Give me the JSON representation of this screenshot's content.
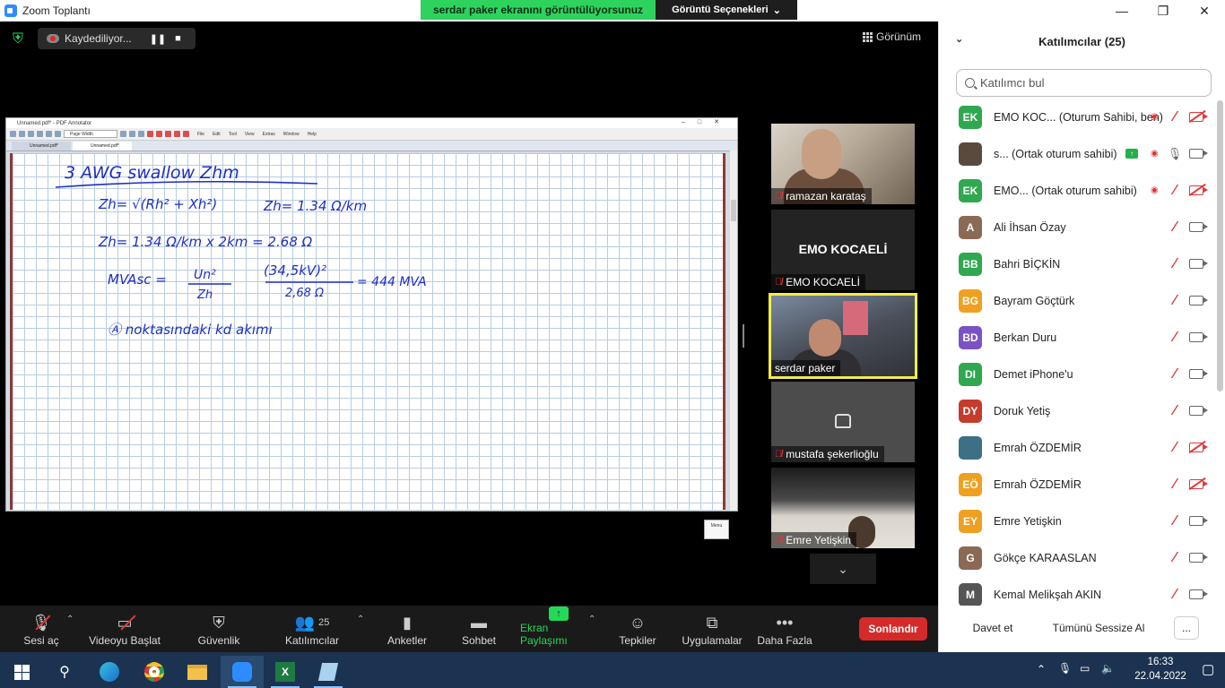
{
  "window": {
    "title": "Zoom Toplantı",
    "share_banner": "serdar paker ekranını görüntülüyorsunuz",
    "view_options": "Görüntü Seçenekleri",
    "min": "—",
    "max": "❐",
    "close": "✕"
  },
  "meeting": {
    "recording_label": "Kaydediliyor...",
    "view_label": "Görünüm"
  },
  "pdf_annotator": {
    "title": "Unnamed.pdf* - PDF Annotator",
    "zoom_value": "Page Width",
    "menus": [
      "File",
      "Edit",
      "Tool",
      "View",
      "Extras",
      "Window",
      "Help"
    ],
    "tabs": [
      "Unnamed.pdf*",
      "Unnamed.pdf*"
    ],
    "menu_button": "Menu"
  },
  "handwriting": {
    "line1": "3 AWG swallow Zhm",
    "line2a": "Zh= √(Rh² + Xh²)",
    "line2b": "Zh= 1.34 Ω/km",
    "line3": "Zh= 1.34 Ω/km x 2km = 2.68 Ω",
    "line4a": "MVAsc =",
    "line4b": "Un²",
    "line4c": "Zh",
    "line4d": "(34,5kV)²",
    "line4e": "2,68 Ω",
    "line4f": "= 444 MVA",
    "line5": "Ⓐ noktasındaki kd akımı"
  },
  "thumbnails": [
    {
      "name": "ramazan karataş",
      "muted": true
    },
    {
      "name": "EMO KOCAELİ",
      "center_name": "EMO KOCAELİ",
      "muted": true
    },
    {
      "name": "serdar paker",
      "muted": false,
      "active_speaker": true
    },
    {
      "name": "mustafa şekerlioğlu",
      "muted": true
    },
    {
      "name": "Emre Yetişkin",
      "muted": true
    }
  ],
  "toolbar": {
    "mute": "Sesi aç",
    "video": "Videoyu Başlat",
    "security": "Güvenlik",
    "participants": "Katılımcılar",
    "participants_count": "25",
    "polls": "Anketler",
    "chat": "Sohbet",
    "share": "Ekran Paylaşımı",
    "reactions": "Tepkiler",
    "apps": "Uygulamalar",
    "more": "Daha Fazla",
    "end": "Sonlandır"
  },
  "panel": {
    "title": "Katılımcılar (25)",
    "search_placeholder": "Katılımcı bul",
    "invite": "Davet et",
    "mute_all": "Tümünü Sessize Al",
    "more": "..."
  },
  "participants": [
    {
      "initials": "EK",
      "color": "#2fa84f",
      "name": "EMO KOC... (Oturum Sahibi, ben)",
      "mic": "off",
      "cam": "off",
      "rec": true
    },
    {
      "initials": "",
      "color": "#5a4a3e",
      "name": "s... (Ortak oturum sahibi)",
      "mic": "on",
      "cam": "on",
      "rec": true,
      "sharing": true
    },
    {
      "initials": "EK",
      "color": "#2fa84f",
      "name": "EMO... (Ortak oturum sahibi)",
      "mic": "off",
      "cam": "off",
      "rec": true
    },
    {
      "initials": "A",
      "color": "#8a6a55",
      "name": "Ali İhsan Özay",
      "mic": "off",
      "cam": "on"
    },
    {
      "initials": "BB",
      "color": "#2fa84f",
      "name": "Bahri BİÇKİN",
      "mic": "off",
      "cam": "on"
    },
    {
      "initials": "BG",
      "color": "#f0a020",
      "name": "Bayram Göçtürk",
      "mic": "off",
      "cam": "on"
    },
    {
      "initials": "BD",
      "color": "#7a52c4",
      "name": "Berkan Duru",
      "mic": "off",
      "cam": "on"
    },
    {
      "initials": "DI",
      "color": "#2fa84f",
      "name": "Demet iPhone'u",
      "mic": "off",
      "cam": "on"
    },
    {
      "initials": "DY",
      "color": "#c53b2c",
      "name": "Doruk Yetiş",
      "mic": "off",
      "cam": "on"
    },
    {
      "initials": "",
      "color": "#3d6f86",
      "name": "Emrah ÖZDEMİR",
      "mic": "off",
      "cam": "off"
    },
    {
      "initials": "EÖ",
      "color": "#f0a020",
      "name": "Emrah ÖZDEMİR",
      "mic": "off",
      "cam": "off"
    },
    {
      "initials": "EY",
      "color": "#f0a020",
      "name": "Emre Yetişkin",
      "mic": "off",
      "cam": "on"
    },
    {
      "initials": "G",
      "color": "#8a6a55",
      "name": "Gökçe KARAASLAN",
      "mic": "off",
      "cam": "on"
    },
    {
      "initials": "M",
      "color": "#555",
      "name": "Kemal Melikşah AKIN",
      "mic": "off",
      "cam": "on"
    }
  ],
  "taskbar": {
    "time": "16:33",
    "date": "22.04.2022",
    "apps": [
      "start",
      "search",
      "edge",
      "chrome",
      "explorer",
      "zoom",
      "excel",
      "notepad"
    ]
  }
}
